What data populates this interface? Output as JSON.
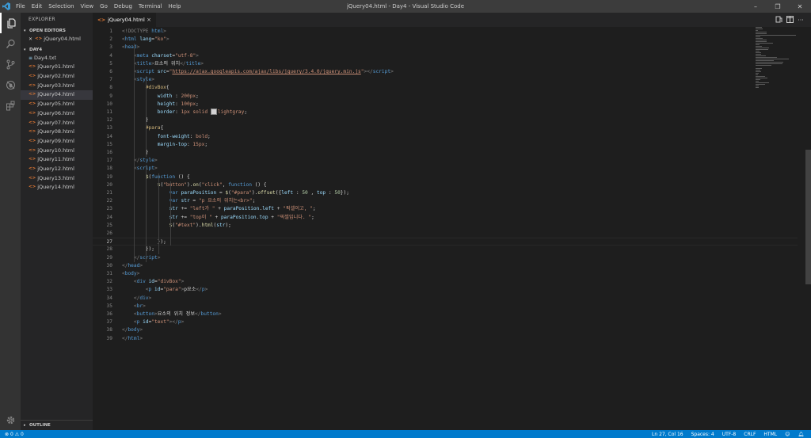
{
  "window": {
    "title": "jQuery04.html - Day4 - Visual Studio Code",
    "menu": [
      "File",
      "Edit",
      "Selection",
      "View",
      "Go",
      "Debug",
      "Terminal",
      "Help"
    ],
    "controls": {
      "minimize": "–",
      "restore": "❐",
      "close": "✕"
    }
  },
  "activity_bar": {
    "items": [
      {
        "name": "explorer-icon",
        "active": true
      },
      {
        "name": "search-icon",
        "active": false
      },
      {
        "name": "source-control-icon",
        "active": false
      },
      {
        "name": "debug-icon",
        "active": false
      },
      {
        "name": "extensions-icon",
        "active": false
      }
    ],
    "settings": "settings-gear-icon"
  },
  "sidebar": {
    "title": "EXPLORER",
    "open_editors_header": "OPEN EDITORS",
    "open_editors": [
      {
        "label": "jQuery04.html"
      }
    ],
    "folder_header": "DAY4",
    "files": [
      {
        "label": "Day4.txt",
        "type": "txt"
      },
      {
        "label": "jQuery01.html",
        "type": "html"
      },
      {
        "label": "jQuery02.html",
        "type": "html"
      },
      {
        "label": "jQuery03.html",
        "type": "html"
      },
      {
        "label": "jQuery04.html",
        "type": "html",
        "selected": true
      },
      {
        "label": "jQuery05.html",
        "type": "html"
      },
      {
        "label": "jQuery06.html",
        "type": "html"
      },
      {
        "label": "jQuery07.html",
        "type": "html"
      },
      {
        "label": "jQuery08.html",
        "type": "html"
      },
      {
        "label": "jQuery09.html",
        "type": "html"
      },
      {
        "label": "jQuery10.html",
        "type": "html"
      },
      {
        "label": "jQuery11.html",
        "type": "html"
      },
      {
        "label": "jQuery12.html",
        "type": "html"
      },
      {
        "label": "jQuery13.html",
        "type": "html"
      },
      {
        "label": "jQuery14.html",
        "type": "html"
      }
    ],
    "outline_header": "OUTLINE"
  },
  "tab": {
    "label": "jQuery04.html",
    "icon": "<>",
    "close": "×"
  },
  "editor_actions": [
    "open-changes-icon",
    "split-editor-icon",
    "more-actions-icon"
  ],
  "editor": {
    "current_line": 27,
    "lines": [
      [
        [
          "t",
          "<!DOCTYPE "
        ],
        [
          "tag",
          "html"
        ],
        [
          "t",
          ">"
        ]
      ],
      [
        [
          "t",
          "<"
        ],
        [
          "tag",
          "html"
        ],
        [
          "attr",
          " lang"
        ],
        [
          "txt",
          "="
        ],
        [
          "str",
          "\"ko\""
        ],
        [
          "t",
          ">"
        ]
      ],
      [
        [
          "t",
          "<"
        ],
        [
          "tag",
          "head"
        ],
        [
          "t",
          ">"
        ]
      ],
      [
        [
          "txt",
          "    "
        ],
        [
          "t",
          "<"
        ],
        [
          "tag",
          "meta"
        ],
        [
          "attr",
          " charset"
        ],
        [
          "txt",
          "="
        ],
        [
          "str",
          "\"utf-8\""
        ],
        [
          "t",
          ">"
        ]
      ],
      [
        [
          "txt",
          "    "
        ],
        [
          "t",
          "<"
        ],
        [
          "tag",
          "title"
        ],
        [
          "t",
          ">"
        ],
        [
          "txt",
          "요소의 위치"
        ],
        [
          "t",
          "</"
        ],
        [
          "tag",
          "title"
        ],
        [
          "t",
          ">"
        ]
      ],
      [
        [
          "txt",
          "    "
        ],
        [
          "t",
          "<"
        ],
        [
          "tag",
          "script"
        ],
        [
          "attr",
          " src"
        ],
        [
          "txt",
          "="
        ],
        [
          "str",
          "\""
        ],
        [
          "url",
          "https://ajax.googleapis.com/ajax/libs/jquery/3.4.0/jquery.min.js"
        ],
        [
          "str",
          "\""
        ],
        [
          "t",
          "></"
        ],
        [
          "tag",
          "script"
        ],
        [
          "t",
          ">"
        ]
      ],
      [
        [
          "txt",
          "    "
        ],
        [
          "t",
          "<"
        ],
        [
          "tag",
          "style"
        ],
        [
          "t",
          ">"
        ]
      ],
      [
        [
          "txt",
          "        "
        ],
        [
          "sel",
          "#divBox"
        ],
        [
          "txt",
          "{"
        ]
      ],
      [
        [
          "txt",
          "            "
        ],
        [
          "prop",
          "width"
        ],
        [
          "txt",
          " : "
        ],
        [
          "str",
          "200px"
        ],
        [
          "txt",
          ";"
        ]
      ],
      [
        [
          "txt",
          "            "
        ],
        [
          "prop",
          "height"
        ],
        [
          "txt",
          ": "
        ],
        [
          "str",
          "100px"
        ],
        [
          "txt",
          ";"
        ]
      ],
      [
        [
          "txt",
          "            "
        ],
        [
          "prop",
          "border"
        ],
        [
          "txt",
          ": "
        ],
        [
          "str",
          "1px solid "
        ],
        [
          "swatch",
          ""
        ],
        [
          "str",
          "lightgray"
        ],
        [
          "txt",
          ";"
        ]
      ],
      [
        [
          "txt",
          "        }"
        ]
      ],
      [
        [
          "txt",
          "        "
        ],
        [
          "sel",
          "#para"
        ],
        [
          "txt",
          "{"
        ]
      ],
      [
        [
          "txt",
          "            "
        ],
        [
          "prop",
          "font-weight"
        ],
        [
          "txt",
          ": "
        ],
        [
          "str",
          "bold"
        ],
        [
          "txt",
          ";"
        ]
      ],
      [
        [
          "txt",
          "            "
        ],
        [
          "prop",
          "margin-top"
        ],
        [
          "txt",
          ": "
        ],
        [
          "str",
          "15px"
        ],
        [
          "txt",
          ";"
        ]
      ],
      [
        [
          "txt",
          "        }"
        ]
      ],
      [
        [
          "txt",
          "    "
        ],
        [
          "t",
          "</"
        ],
        [
          "tag",
          "style"
        ],
        [
          "t",
          ">"
        ]
      ],
      [
        [
          "txt",
          "    "
        ],
        [
          "t",
          "<"
        ],
        [
          "tag",
          "script"
        ],
        [
          "t",
          ">"
        ]
      ],
      [
        [
          "txt",
          "        "
        ],
        [
          "fn",
          "$"
        ],
        [
          "txt",
          "("
        ],
        [
          "kw",
          "function"
        ],
        [
          "txt",
          " () {"
        ]
      ],
      [
        [
          "txt",
          "            "
        ],
        [
          "fn",
          "$"
        ],
        [
          "txt",
          "("
        ],
        [
          "str",
          "\"button\""
        ],
        [
          "txt",
          ")."
        ],
        [
          "fn",
          "on"
        ],
        [
          "txt",
          "("
        ],
        [
          "str",
          "\"click\""
        ],
        [
          "txt",
          ", "
        ],
        [
          "kw",
          "function"
        ],
        [
          "txt",
          " () {"
        ]
      ],
      [
        [
          "txt",
          "                "
        ],
        [
          "kw",
          "var"
        ],
        [
          "var",
          " paraPosition"
        ],
        [
          "txt",
          " = "
        ],
        [
          "fn",
          "$"
        ],
        [
          "txt",
          "("
        ],
        [
          "str",
          "\"#para\""
        ],
        [
          "txt",
          ")."
        ],
        [
          "fn",
          "offset"
        ],
        [
          "txt",
          "({"
        ],
        [
          "var",
          "left"
        ],
        [
          "txt",
          " : "
        ],
        [
          "num",
          "50"
        ],
        [
          "txt",
          " , "
        ],
        [
          "var",
          "top"
        ],
        [
          "txt",
          " : "
        ],
        [
          "num",
          "50"
        ],
        [
          "txt",
          "});"
        ]
      ],
      [
        [
          "txt",
          "                "
        ],
        [
          "kw",
          "var"
        ],
        [
          "var",
          " str"
        ],
        [
          "txt",
          " = "
        ],
        [
          "str",
          "\"p 요소의 위치는<br>\""
        ],
        [
          "txt",
          ";"
        ]
      ],
      [
        [
          "txt",
          "                "
        ],
        [
          "var",
          "str"
        ],
        [
          "txt",
          " += "
        ],
        [
          "str",
          "\"left가 \""
        ],
        [
          "txt",
          " + "
        ],
        [
          "var",
          "paraPosition"
        ],
        [
          "txt",
          "."
        ],
        [
          "var",
          "left"
        ],
        [
          "txt",
          " + "
        ],
        [
          "str",
          "\"픽셀이고, \""
        ],
        [
          "txt",
          ";"
        ]
      ],
      [
        [
          "txt",
          "                "
        ],
        [
          "var",
          "str"
        ],
        [
          "txt",
          " += "
        ],
        [
          "str",
          "\"top이 \""
        ],
        [
          "txt",
          " + "
        ],
        [
          "var",
          "paraPosition"
        ],
        [
          "txt",
          "."
        ],
        [
          "var",
          "top"
        ],
        [
          "txt",
          " + "
        ],
        [
          "str",
          "\"픽셀입니다. \""
        ],
        [
          "txt",
          ";"
        ]
      ],
      [
        [
          "txt",
          "                "
        ],
        [
          "fn",
          "$"
        ],
        [
          "txt",
          "("
        ],
        [
          "str",
          "\"#text\""
        ],
        [
          "txt",
          ")."
        ],
        [
          "fn",
          "html"
        ],
        [
          "txt",
          "("
        ],
        [
          "var",
          "str"
        ],
        [
          "txt",
          ");"
        ]
      ],
      [],
      [
        [
          "txt",
          "            });"
        ]
      ],
      [
        [
          "txt",
          "        });"
        ]
      ],
      [
        [
          "txt",
          "    "
        ],
        [
          "t",
          "</"
        ],
        [
          "tag",
          "script"
        ],
        [
          "t",
          ">"
        ]
      ],
      [
        [
          "t",
          "</"
        ],
        [
          "tag",
          "head"
        ],
        [
          "t",
          ">"
        ]
      ],
      [
        [
          "t",
          "<"
        ],
        [
          "tag",
          "body"
        ],
        [
          "t",
          ">"
        ]
      ],
      [
        [
          "txt",
          "    "
        ],
        [
          "t",
          "<"
        ],
        [
          "tag",
          "div"
        ],
        [
          "attr",
          " id"
        ],
        [
          "txt",
          "="
        ],
        [
          "str",
          "\"divBox\""
        ],
        [
          "t",
          ">"
        ]
      ],
      [
        [
          "txt",
          "        "
        ],
        [
          "t",
          "<"
        ],
        [
          "tag",
          "p"
        ],
        [
          "attr",
          " id"
        ],
        [
          "txt",
          "="
        ],
        [
          "str",
          "\"para\""
        ],
        [
          "t",
          ">"
        ],
        [
          "txt",
          "p요소"
        ],
        [
          "t",
          "</"
        ],
        [
          "tag",
          "p"
        ],
        [
          "t",
          ">"
        ]
      ],
      [
        [
          "txt",
          "    "
        ],
        [
          "t",
          "</"
        ],
        [
          "tag",
          "div"
        ],
        [
          "t",
          ">"
        ]
      ],
      [
        [
          "txt",
          "    "
        ],
        [
          "t",
          "<"
        ],
        [
          "tag",
          "br"
        ],
        [
          "t",
          ">"
        ]
      ],
      [
        [
          "txt",
          "    "
        ],
        [
          "t",
          "<"
        ],
        [
          "tag",
          "button"
        ],
        [
          "t",
          ">"
        ],
        [
          "txt",
          "요소의 위치 정보"
        ],
        [
          "t",
          "</"
        ],
        [
          "tag",
          "button"
        ],
        [
          "t",
          ">"
        ]
      ],
      [
        [
          "txt",
          "    "
        ],
        [
          "t",
          "<"
        ],
        [
          "tag",
          "p"
        ],
        [
          "attr",
          " id"
        ],
        [
          "txt",
          "="
        ],
        [
          "str",
          "\"text\""
        ],
        [
          "t",
          "></"
        ],
        [
          "tag",
          "p"
        ],
        [
          "t",
          ">"
        ]
      ],
      [
        [
          "t",
          "</"
        ],
        [
          "tag",
          "body"
        ],
        [
          "t",
          ">"
        ]
      ],
      [
        [
          "t",
          "</"
        ],
        [
          "tag",
          "html"
        ],
        [
          "t",
          ">"
        ]
      ]
    ]
  },
  "status_bar": {
    "errors": "0",
    "warnings": "0",
    "position": "Ln 27, Col 16",
    "spaces": "Spaces: 4",
    "encoding": "UTF-8",
    "eol": "CRLF",
    "language": "HTML",
    "feedback_icon": "smiley-icon",
    "notifications_icon": "bell-icon"
  },
  "colors": {
    "accent": "#007acc",
    "editor_bg": "#1e1e1e",
    "sidebar_bg": "#252526",
    "activity_bg": "#333333",
    "title_bg": "#3c3c3c",
    "html_icon": "#e37933"
  }
}
